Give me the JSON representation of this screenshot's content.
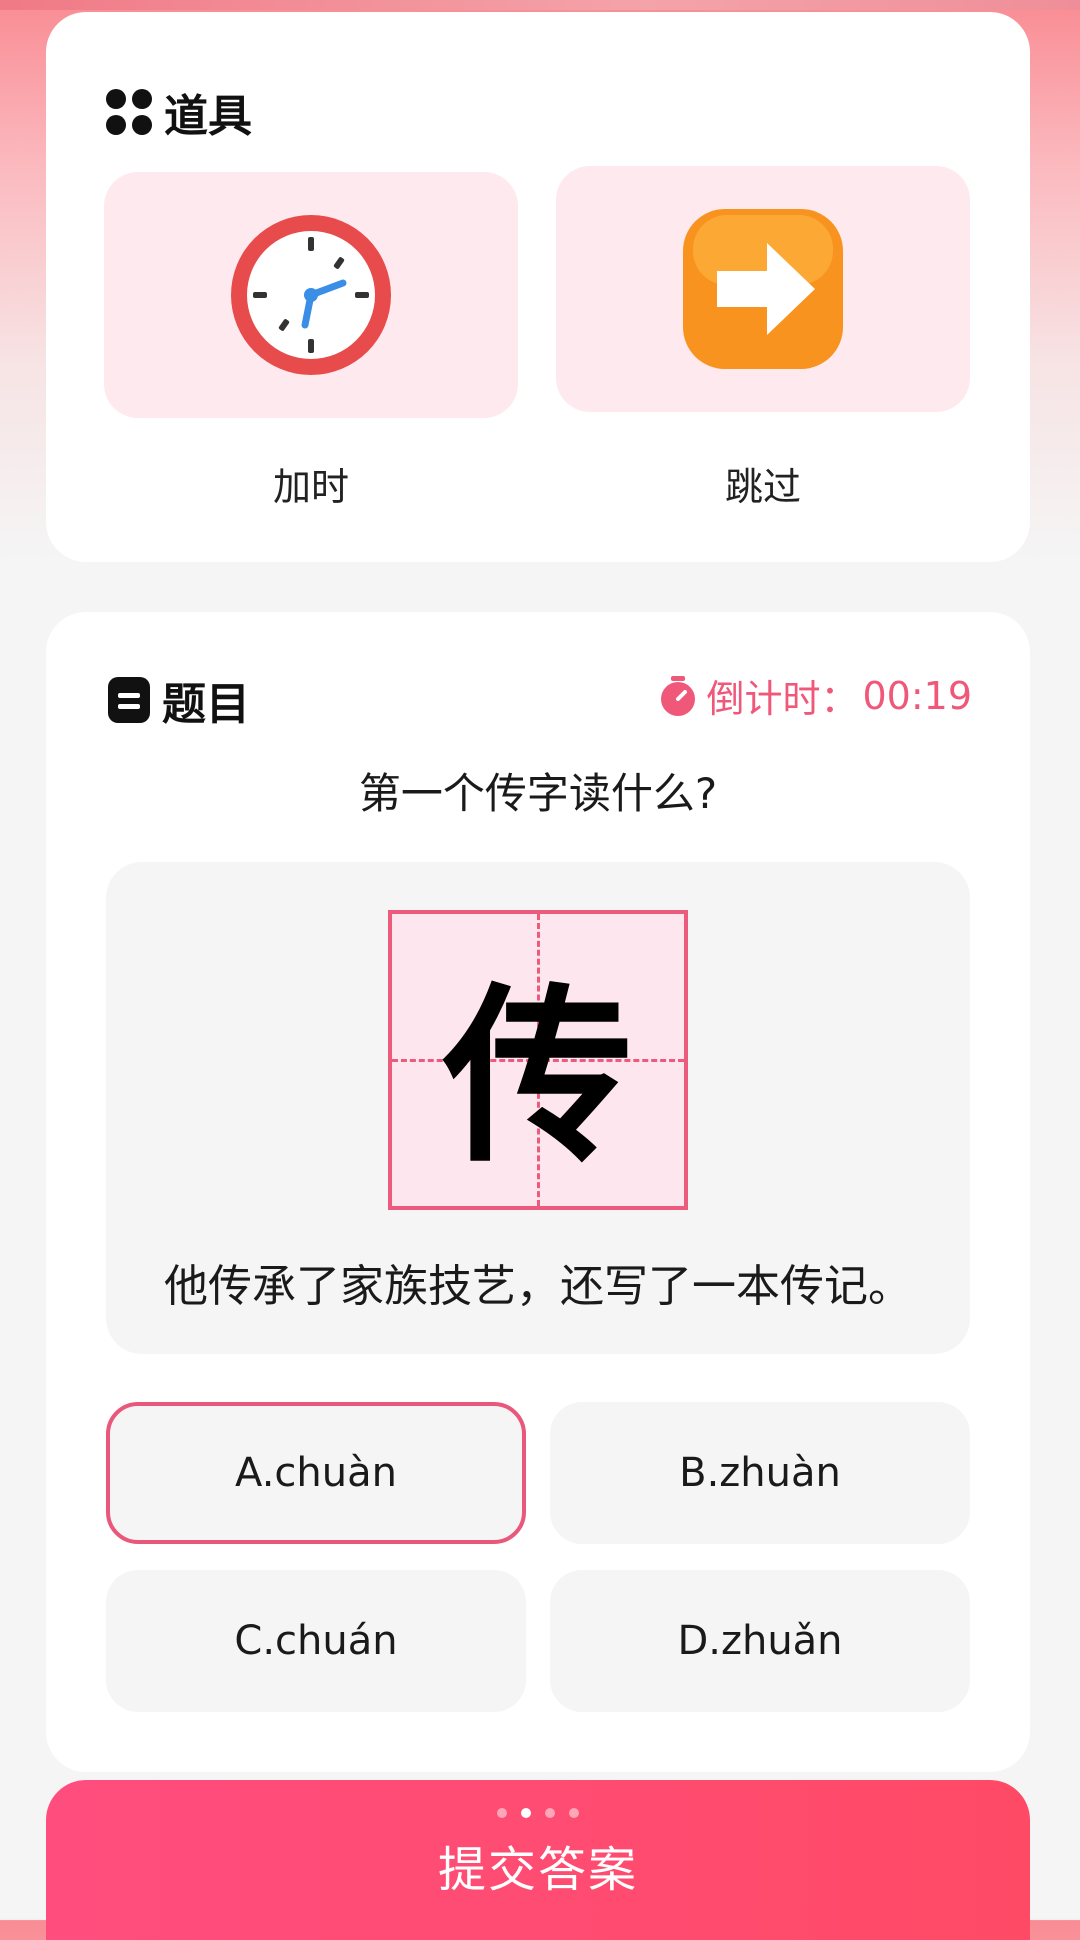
{
  "props": {
    "title": "道具",
    "items": [
      {
        "label": "加时",
        "icon": "alarm-clock-icon"
      },
      {
        "label": "跳过",
        "icon": "arrow-right-icon"
      }
    ]
  },
  "question": {
    "title": "题目",
    "countdown_label": "倒计时：",
    "countdown_value": "00:19",
    "prompt": "第一个传字读什么?",
    "character": "传",
    "sentence": "他传承了家族技艺，还写了一本传记。",
    "options": [
      {
        "label": "A.chuàn",
        "selected": true
      },
      {
        "label": "B.zhuàn",
        "selected": false
      },
      {
        "label": "C.chuán",
        "selected": false
      },
      {
        "label": "D.zhuǎn",
        "selected": false
      }
    ]
  },
  "submit": {
    "label": "提交答案",
    "page_dots": {
      "count": 4,
      "active_index": 1
    }
  },
  "colors": {
    "accent": "#f0587a",
    "prop_tile_bg": "#fde9ee",
    "submit_gradient_start": "#ff4d7e",
    "submit_gradient_end": "#ff4a66"
  }
}
